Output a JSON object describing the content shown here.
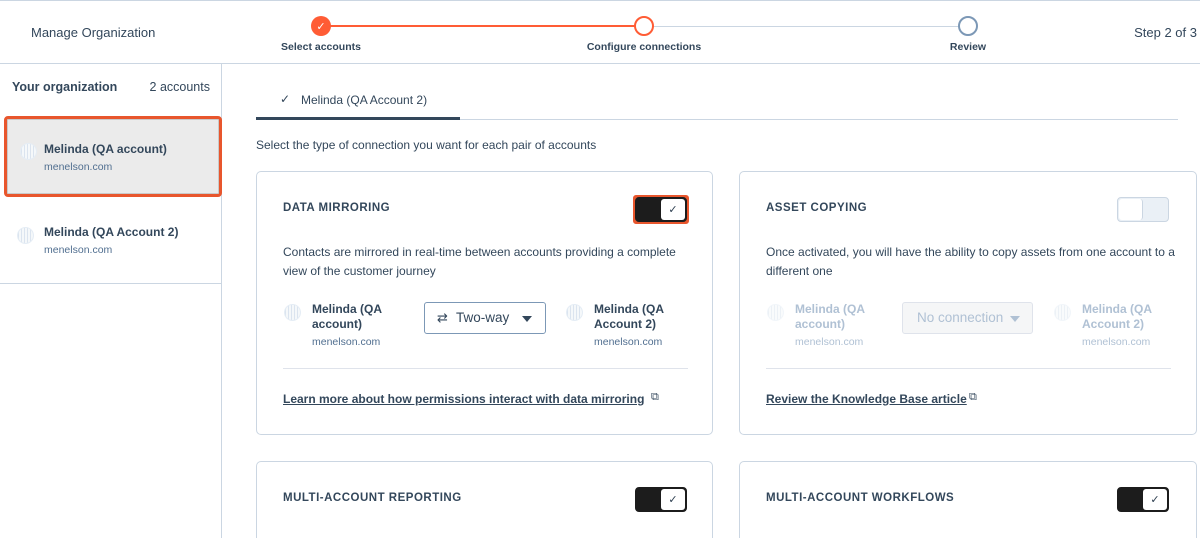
{
  "header": {
    "app_title": "Manage Organization",
    "step_indicator": "Step 2 of 3",
    "steps": [
      {
        "label": "Select accounts",
        "status": "done"
      },
      {
        "label": "Configure connections",
        "status": "active"
      },
      {
        "label": "Review",
        "status": "todo"
      }
    ],
    "done_check": "✓"
  },
  "sidebar": {
    "title": "Your organization",
    "count": "2 accounts",
    "accounts": [
      {
        "name": "Melinda (QA account)",
        "domain": "menelson.com",
        "selected": true
      },
      {
        "name": "Melinda (QA Account 2)",
        "domain": "menelson.com",
        "selected": false
      }
    ]
  },
  "main": {
    "tab": {
      "check": "✓",
      "label": "Melinda (QA Account 2)"
    },
    "intro": "Select the type of connection you want for each pair of accounts",
    "cards": {
      "data_mirroring": {
        "title": "DATA MIRRORING",
        "toggle_on": true,
        "toggle_check": "✓",
        "description": "Contacts are mirrored in real-time between accounts providing a complete view of the customer journey",
        "left_account": {
          "name": "Melinda (QA account)",
          "domain": "menelson.com"
        },
        "right_account": {
          "name": "Melinda (QA Account 2)",
          "domain": "menelson.com"
        },
        "select_icon": "⇄",
        "select_value": "Two-way",
        "link": "Learn more about how permissions interact with data mirroring",
        "link_icon": "⧉"
      },
      "asset_copying": {
        "title": "ASSET COPYING",
        "toggle_on": false,
        "description": "Once activated, you will have the ability to copy assets from one account to a different one",
        "left_account": {
          "name": "Melinda (QA account)",
          "domain": "menelson.com"
        },
        "right_account": {
          "name": "Melinda (QA Account 2)",
          "domain": "menelson.com"
        },
        "select_value": "No connection",
        "link": "Review the Knowledge Base article",
        "link_icon": "⧉"
      },
      "multi_account_reporting": {
        "title": "MULTI-ACCOUNT REPORTING",
        "toggle_on": true,
        "toggle_check": "✓"
      },
      "multi_account_workflows": {
        "title": "MULTI-ACCOUNT WORKFLOWS",
        "toggle_on": true,
        "toggle_check": "✓"
      }
    }
  },
  "colors": {
    "accent": "#ff5c35",
    "highlight": "#e8562d",
    "text": "#33475b",
    "toggle_on": "#1c1c1c",
    "border": "#cbd6e2"
  }
}
